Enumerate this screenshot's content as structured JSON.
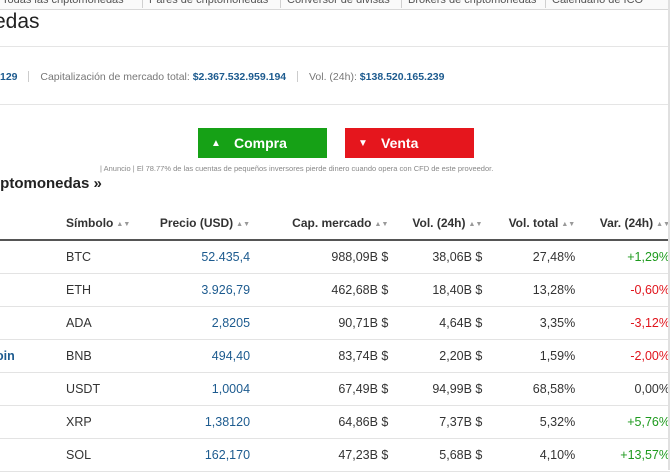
{
  "topnav": {
    "tabs": [
      "Todas las criptomonedas",
      "Pares de criptomonedas",
      "Conversor de divisas",
      "Brokers de criptomonedas",
      "Calendario de ICO"
    ]
  },
  "page": {
    "title": "edas"
  },
  "stats": {
    "count_partial": "129",
    "market_cap_label": "Capitalización de mercado total:",
    "market_cap_value": "$2.367.532.959.194",
    "volume_label": "Vol. (24h):",
    "volume_value": "$138.520.165.239"
  },
  "ad": {
    "buy_label": "Compra",
    "sell_label": "Venta",
    "buy_color": "#16a116",
    "sell_color": "#e5161d",
    "disclaimer": "| Anuncio | El 78.77% de las cuentas de pequeños inversores pierde dinero cuando opera con CFD de este proveedor."
  },
  "section": {
    "title": "iptomonedas »"
  },
  "table": {
    "headers": [
      "Símbolo",
      "Precio (USD)",
      "Cap. mercado",
      "Vol. (24h)",
      "Vol. total",
      "Var. (24h)"
    ],
    "rows": [
      {
        "name": "",
        "symbol": "BTC",
        "price": "52.435,4",
        "cap": "988,09B $",
        "vol24": "38,06B $",
        "voltotal": "27,48%",
        "change": "+1,29%",
        "dir": "up"
      },
      {
        "name": "",
        "symbol": "ETH",
        "price": "3.926,79",
        "cap": "462,68B $",
        "vol24": "18,40B $",
        "voltotal": "13,28%",
        "change": "-0,60%",
        "dir": "down"
      },
      {
        "name": "",
        "symbol": "ADA",
        "price": "2,8205",
        "cap": "90,71B $",
        "vol24": "4,64B $",
        "voltotal": "3,35%",
        "change": "-3,12%",
        "dir": "down"
      },
      {
        "name": "oin",
        "symbol": "BNB",
        "price": "494,40",
        "cap": "83,74B $",
        "vol24": "2,20B $",
        "voltotal": "1,59%",
        "change": "-2,00%",
        "dir": "down"
      },
      {
        "name": "",
        "symbol": "USDT",
        "price": "1,0004",
        "cap": "67,49B $",
        "vol24": "94,99B $",
        "voltotal": "68,58%",
        "change": "0,00%",
        "dir": "flat"
      },
      {
        "name": "",
        "symbol": "XRP",
        "price": "1,38120",
        "cap": "64,86B $",
        "vol24": "7,37B $",
        "voltotal": "5,32%",
        "change": "+5,76%",
        "dir": "up"
      },
      {
        "name": "",
        "symbol": "SOL",
        "price": "162,170",
        "cap": "47,23B $",
        "vol24": "5,68B $",
        "voltotal": "4,10%",
        "change": "+13,57%",
        "dir": "up"
      }
    ]
  }
}
